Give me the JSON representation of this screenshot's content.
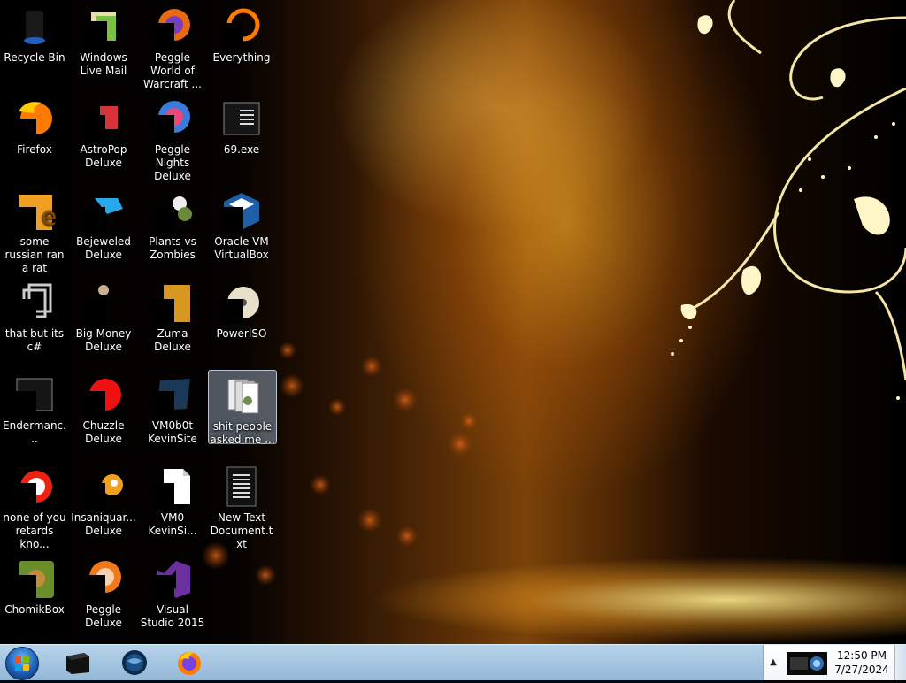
{
  "desktop": {
    "icons": [
      {
        "label": "Recycle Bin",
        "icon": "recycle-bin-icon"
      },
      {
        "label": "Windows Live Mail",
        "icon": "windows-live-mail-icon"
      },
      {
        "label": "Peggle World of Warcraft ...",
        "icon": "peggle-world-of-warcraft-icon"
      },
      {
        "label": "Everything",
        "icon": "everything-search-icon"
      },
      {
        "label": "Firefox",
        "icon": "firefox-icon"
      },
      {
        "label": "AstroPop Deluxe",
        "icon": "astropop-icon"
      },
      {
        "label": "Peggle Nights Deluxe",
        "icon": "peggle-nights-icon"
      },
      {
        "label": "69.exe",
        "icon": "exe-file-icon"
      },
      {
        "label": "some russian ran a rat",
        "icon": "russian-rat-icon"
      },
      {
        "label": "Bejeweled Deluxe",
        "icon": "bejeweled-icon"
      },
      {
        "label": "Plants vs Zombies",
        "icon": "plants-vs-zombies-icon"
      },
      {
        "label": "Oracle VM VirtualBox",
        "icon": "virtualbox-icon"
      },
      {
        "label": "that but its c#",
        "icon": "shortcut-file-icon"
      },
      {
        "label": "Big Money Deluxe",
        "icon": "big-money-icon"
      },
      {
        "label": "Zuma Deluxe",
        "icon": "zuma-icon"
      },
      {
        "label": "PowerISO",
        "icon": "poweriso-icon"
      },
      {
        "label": "Endermanc...",
        "icon": "endermanch-icon"
      },
      {
        "label": "Chuzzle Deluxe",
        "icon": "chuzzle-icon"
      },
      {
        "label": "VM0b0t KevinSite",
        "icon": "vm0b0t-kevinsite-icon"
      },
      {
        "label": "shit people asked me ...",
        "icon": "folder-icon",
        "selected": true
      },
      {
        "label": "none of you retards kno...",
        "icon": "none-of-you-icon"
      },
      {
        "label": "Insaniquar... Deluxe",
        "icon": "insaniquarium-icon"
      },
      {
        "label": "VM0 KevinSi...",
        "icon": "document-file-icon"
      },
      {
        "label": "New Text Document.txt",
        "icon": "text-document-icon"
      },
      {
        "label": "ChomikBox",
        "icon": "chomikbox-icon"
      },
      {
        "label": "Peggle Deluxe",
        "icon": "peggle-deluxe-icon"
      },
      {
        "label": "Visual Studio 2015",
        "icon": "visual-studio-icon"
      }
    ]
  },
  "taskbar": {
    "start_button": "start-orb-icon",
    "pinned": [
      {
        "name": "taskbar-app-1",
        "icon": "black-box-app-icon"
      },
      {
        "name": "taskbar-app-2",
        "icon": "globe-app-icon"
      },
      {
        "name": "taskbar-firefox",
        "icon": "firefox-icon"
      }
    ],
    "tray": {
      "chevron": "▲",
      "clock_time": "12:50 PM",
      "clock_date": "7/27/2024"
    }
  },
  "colors": {
    "taskbar": "#a6c6e2",
    "selection": "#aabed7",
    "wallpaper_glow": "#f5b31c"
  }
}
